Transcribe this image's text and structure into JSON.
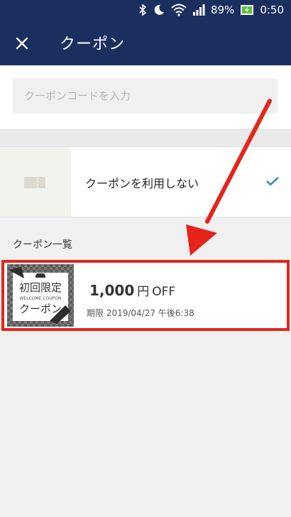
{
  "status_bar": {
    "battery": "89%",
    "time": "0:50",
    "icons": [
      "bluetooth-icon",
      "moon-icon",
      "wifi-icon",
      "signal-icon",
      "battery-icon"
    ]
  },
  "header": {
    "close_icon": "close-icon",
    "title": "クーポン"
  },
  "search": {
    "placeholder": "クーポンコードを入力",
    "value": ""
  },
  "no_coupon_option": {
    "label": "クーポンを利用しない",
    "selected": true,
    "icon": "ticket-icon",
    "check_icon": "check-icon"
  },
  "coupon_list": {
    "title": "クーポン一覧",
    "items": [
      {
        "badge_line1": "初回限定",
        "badge_sub": "WELCOME COUPON",
        "badge_line2": "クーポン",
        "amount": "1,000",
        "unit": "円",
        "off": "OFF",
        "expiry": "期限 2019/04/27 午後6:38",
        "highlighted": true
      }
    ]
  },
  "colors": {
    "header_bg": "#1b2f5f",
    "highlight": "#e5251b",
    "check": "#2f7fc1"
  }
}
